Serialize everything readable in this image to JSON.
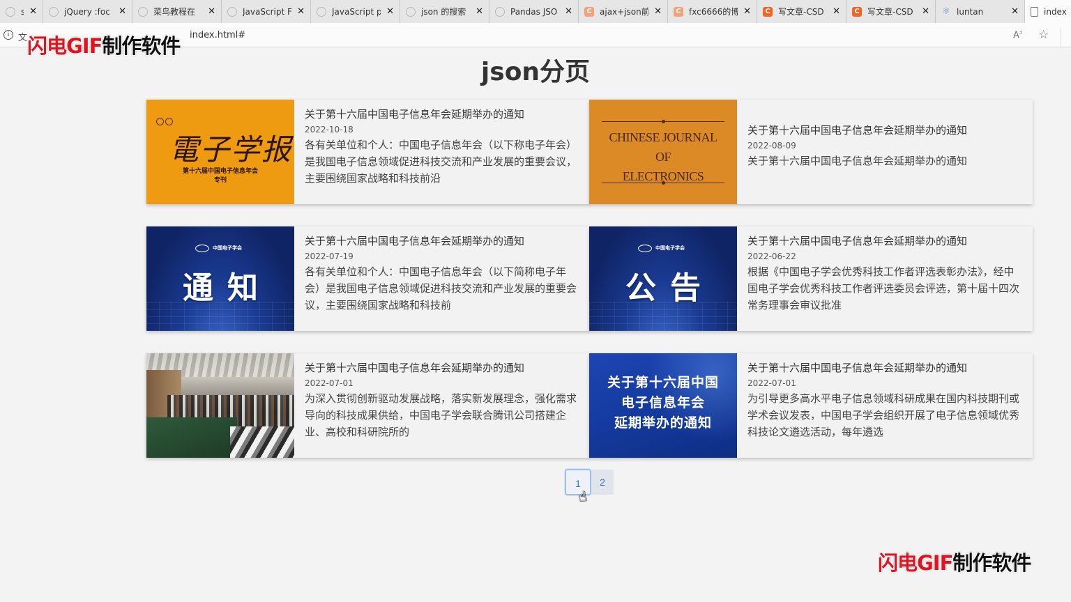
{
  "browser": {
    "tabs": [
      {
        "label": "s - 搜",
        "icon": "ghost",
        "width": 62
      },
      {
        "label": "jQuery :foc",
        "icon": "ghost",
        "width": 128
      },
      {
        "label": "菜鸟教程在",
        "icon": "ghost",
        "width": 128
      },
      {
        "label": "JavaScript F",
        "icon": "ghost",
        "width": 128
      },
      {
        "label": "JavaScript p",
        "icon": "ghost",
        "width": 128
      },
      {
        "label": "json 的搜索",
        "icon": "ghost",
        "width": 128
      },
      {
        "label": "Pandas JSO",
        "icon": "ghost",
        "width": 128
      },
      {
        "label": "ajax+json前",
        "icon": "csdn-light",
        "width": 128
      },
      {
        "label": "fxc6666的博",
        "icon": "csdn-light",
        "width": 128
      },
      {
        "label": "写文章-CSD",
        "icon": "csdn",
        "width": 128
      },
      {
        "label": "写文章-CSD",
        "icon": "csdn",
        "width": 128
      },
      {
        "label": "luntan",
        "icon": "react",
        "width": 128
      },
      {
        "label": "index",
        "icon": "doc",
        "width": 80,
        "active": true
      }
    ],
    "tab_close_glyph": "✕",
    "address": {
      "prefix": "文",
      "url": "index.html#"
    }
  },
  "watermark": {
    "text_red": "闪电GIF",
    "text_black": "制作软件"
  },
  "page": {
    "title": "json分页"
  },
  "cards": [
    {
      "title": "关于第十六届中国电子信息年会延期举办的通知",
      "date": "2022-10-18",
      "desc": "各有关单位和个人：中国电子信息年会（以下称电子年会）是我国电子信息领域促进科技交流和产业发展的重要会议，主要围绕国家战略和科技前沿",
      "thumb": {
        "kind": "orange",
        "calligraphy": "電子学报",
        "sub1": "第十六届中国电子信息年会",
        "sub2": "专刊"
      }
    },
    {
      "title": "关于第十六届中国电子信息年会延期举办的通知",
      "date": "2022-08-09",
      "desc": "关于第十六届中国电子信息年会延期举办的通知",
      "thumb": {
        "kind": "journal",
        "line1": "CHINESE JOURNAL",
        "line2": "OF",
        "line3": "ELECTRONICS"
      }
    },
    {
      "title": "关于第十六届中国电子信息年会延期举办的通知",
      "date": "2022-07-19",
      "desc": "各有关单位和个人：中国电子信息年会（以下简称电子年会）是我国电子信息领域促进科技交流和产业发展的重要会议，主要围绕国家战略和科技前",
      "thumb": {
        "kind": "blue",
        "big": "通知",
        "logo": "中国电子学会"
      }
    },
    {
      "title": "关于第十六届中国电子信息年会延期举办的通知",
      "date": "2022-06-22",
      "desc": "根据《中国电子学会优秀科技工作者评选表彰办法》，经中国电子学会优秀科技工作者评选委员会评选，第十届十四次常务理事会审议批准",
      "thumb": {
        "kind": "blue",
        "big": "公告",
        "logo": "中国电子学会"
      }
    },
    {
      "title": "关于第十六届中国电子信息年会延期举办的通知",
      "date": "2022-07-01",
      "desc": "为深入贯彻创新驱动发展战略，落实新发展理念，强化需求导向的科技成果供给，中国电子学会联合腾讯公司搭建企业、高校和科研院所的",
      "thumb": {
        "kind": "photo"
      }
    },
    {
      "title": "关于第十六届中国电子信息年会延期举办的通知",
      "date": "2022-07-01",
      "desc": "为引导更多高水平电子信息领域科研成果在国内科技期刊或学术会议发表，中国电子学会组织开展了电子信息领域优秀科技论文遴选活动，每年遴选",
      "thumb": {
        "kind": "notice",
        "line1": "关于第十六届中国",
        "line2": "电子信息年会",
        "line3": "延期举办的通知"
      }
    }
  ],
  "pagination": {
    "pages": [
      "1",
      "2"
    ],
    "current": "1"
  },
  "colors": {
    "page_bg": "#f3f3f3",
    "link_blue": "#3278c8",
    "watermark_red": "#e0141e"
  }
}
